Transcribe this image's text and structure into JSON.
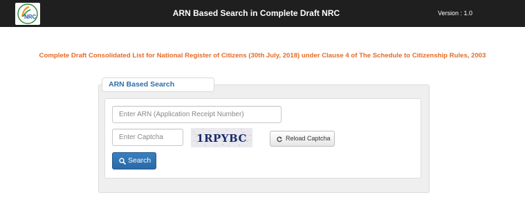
{
  "header": {
    "logo_text": "NRC",
    "title": "ARN Based Search in Complete Draft NRC",
    "version": "Version : 1.0"
  },
  "subtitle": "Complete Draft Consolidated List for National Register of Citizens (30th July, 2018) under Clause 4 of The Schedule to Citizenship Rules, 2003",
  "form": {
    "legend": "ARN Based Search",
    "arn_placeholder": "Enter ARN (Application Receipt Number)",
    "captcha_placeholder": "Enter Captcha",
    "captcha_text": "1RPYBC",
    "reload_label": "Reload Captcha",
    "reload_icon": "refresh-icon",
    "search_label": "Search",
    "search_icon": "search-icon"
  },
  "colors": {
    "navbar": "#1f1f1f",
    "subtitle": "#e46b27",
    "legend": "#2e6ea6",
    "primary_button": "#2f72b3"
  }
}
